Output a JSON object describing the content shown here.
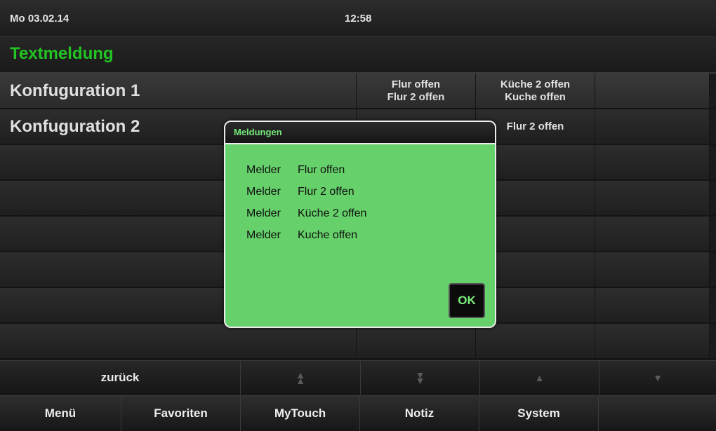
{
  "status": {
    "date": "Mo 03.02.14",
    "time": "12:58"
  },
  "page": {
    "title": "Textmeldung"
  },
  "rows": [
    {
      "label": "Konfuguration 1",
      "col1": [
        "Flur offen",
        "Flur 2 offen"
      ],
      "col2": [
        "Küche 2 offen",
        "Kuche offen"
      ]
    },
    {
      "label": "Konfuguration 2",
      "col1": [],
      "col2": [
        "Flur 2 offen"
      ]
    }
  ],
  "nav": {
    "back_label": "zurück",
    "icons": [
      "double-chevron-up-icon",
      "double-chevron-down-icon",
      "chevron-up-icon",
      "chevron-down-icon"
    ]
  },
  "bottom": {
    "items": [
      "Menü",
      "Favoriten",
      "MyTouch",
      "Notiz",
      "System"
    ]
  },
  "dialog": {
    "title": "Meldungen",
    "messages": [
      {
        "sender": "Melder",
        "text": "Flur offen"
      },
      {
        "sender": "Melder",
        "text": "Flur 2 offen"
      },
      {
        "sender": "Melder",
        "text": "Küche 2 offen"
      },
      {
        "sender": "Melder",
        "text": "Kuche offen"
      }
    ],
    "ok_label": "OK"
  },
  "colors": {
    "accent": "#22c322",
    "dialog_bg": "#66d16a",
    "ok_text": "#7cf07e"
  }
}
